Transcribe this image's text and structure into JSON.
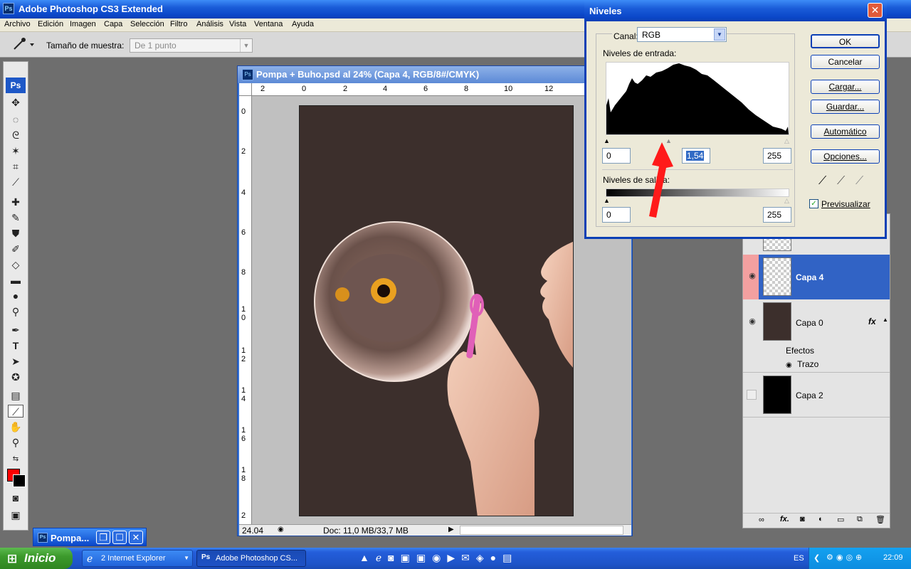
{
  "app": {
    "title": "Adobe Photoshop CS3 Extended",
    "logo": "Ps"
  },
  "menu": [
    "Archivo",
    "Edición",
    "Imagen",
    "Capa",
    "Selección",
    "Filtro",
    "Análisis",
    "Vista",
    "Ventana",
    "Ayuda"
  ],
  "options": {
    "sample_label": "Tamaño de muestra:",
    "sample_value": "De 1 punto"
  },
  "document": {
    "title": "Pompa + Buho.psd al 24% (Capa 4, RGB/8#/CMYK)",
    "zoom": "24.04",
    "doc_info": "Doc: 11,0 MB/33,7 MB",
    "hruler": [
      "2",
      "0",
      "2",
      "4",
      "6",
      "8",
      "10",
      "12"
    ],
    "vruler": [
      "0",
      "2",
      "4",
      "6",
      "8",
      "1\n0",
      "1\n2",
      "1\n4",
      "1\n6",
      "1\n8",
      "2"
    ]
  },
  "levels": {
    "title": "Niveles",
    "channel_label": "Canal:",
    "channel_value": "RGB",
    "input_label": "Niveles de entrada:",
    "input_black": "0",
    "input_gamma": "1,54",
    "input_white": "255",
    "output_label": "Niveles de salida:",
    "output_black": "0",
    "output_white": "255",
    "buttons": {
      "ok": "OK",
      "cancel": "Cancelar",
      "load": "Cargar...",
      "save": "Guardar...",
      "auto": "Automático",
      "options": "Opciones..."
    },
    "preview_label": "Previsualizar",
    "preview_checked": true
  },
  "layers": {
    "items": [
      {
        "name": "Capa 4",
        "visible": true,
        "selected": true
      },
      {
        "name": "Capa 0",
        "visible": true,
        "selected": false,
        "fx": "fx",
        "effects_label": "Efectos",
        "effect": "Trazo"
      },
      {
        "name": "Capa 2",
        "visible": false,
        "selected": false
      }
    ]
  },
  "minimized_doc": {
    "label": "Pompa..."
  },
  "taskbar": {
    "start": "Inicio",
    "items": [
      "2 Internet Explorer",
      "Adobe Photoshop CS..."
    ],
    "lang": "ES",
    "time": "22:09"
  },
  "colors": {
    "foreground": "#ff0000",
    "background": "#000000",
    "accent": "#3163c5"
  }
}
